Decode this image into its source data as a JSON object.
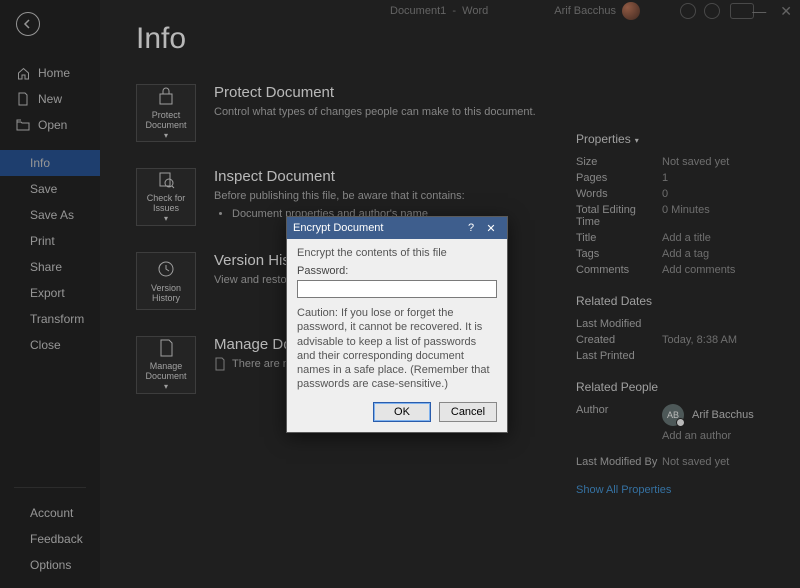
{
  "titlebar": {
    "document": "Document1",
    "app": "Word",
    "user": "Arif Bacchus"
  },
  "sidebar": {
    "items": [
      {
        "icon": "home",
        "label": "Home"
      },
      {
        "icon": "new",
        "label": "New"
      },
      {
        "icon": "open",
        "label": "Open"
      },
      {
        "icon": "",
        "label": "Info",
        "selected": true
      },
      {
        "icon": "",
        "label": "Save"
      },
      {
        "icon": "",
        "label": "Save As"
      },
      {
        "icon": "",
        "label": "Print"
      },
      {
        "icon": "",
        "label": "Share"
      },
      {
        "icon": "",
        "label": "Export"
      },
      {
        "icon": "",
        "label": "Transform"
      },
      {
        "icon": "",
        "label": "Close"
      }
    ],
    "footer": [
      "Account",
      "Feedback",
      "Options"
    ]
  },
  "page": {
    "title": "Info"
  },
  "sections": {
    "protect": {
      "button": "Protect Document",
      "title": "Protect Document",
      "desc": "Control what types of changes people can make to this document."
    },
    "inspect": {
      "button": "Check for Issues",
      "title": "Inspect Document",
      "desc": "Before publishing this file, be aware that it contains:",
      "bullet": "Document properties and author's name"
    },
    "version": {
      "button": "Version History",
      "title": "Version History",
      "desc": "View and restore previous versions."
    },
    "manage": {
      "button": "Manage Document",
      "title": "Manage Document",
      "desc": "There are no unsaved changes."
    }
  },
  "properties": {
    "heading": "Properties",
    "rows": [
      {
        "k": "Size",
        "v": "Not saved yet"
      },
      {
        "k": "Pages",
        "v": "1"
      },
      {
        "k": "Words",
        "v": "0"
      },
      {
        "k": "Total Editing Time",
        "v": "0 Minutes"
      },
      {
        "k": "Title",
        "v": "Add a title"
      },
      {
        "k": "Tags",
        "v": "Add a tag"
      },
      {
        "k": "Comments",
        "v": "Add comments"
      }
    ],
    "dates_heading": "Related Dates",
    "dates": [
      {
        "k": "Last Modified",
        "v": ""
      },
      {
        "k": "Created",
        "v": "Today, 8:38 AM"
      },
      {
        "k": "Last Printed",
        "v": ""
      }
    ],
    "people_heading": "Related People",
    "author_label": "Author",
    "author_initials": "AB",
    "author_name": "Arif Bacchus",
    "add_author": "Add an author",
    "modified_label": "Last Modified By",
    "modified_value": "Not saved yet",
    "show_all": "Show All Properties"
  },
  "dialog": {
    "title": "Encrypt Document",
    "lead": "Encrypt the contents of this file",
    "password_label": "Password:",
    "password_value": "",
    "caution": "Caution: If you lose or forget the password, it cannot be recovered. It is advisable to keep a list of passwords and their corresponding document names in a safe place. (Remember that passwords are case-sensitive.)",
    "ok": "OK",
    "cancel": "Cancel"
  }
}
